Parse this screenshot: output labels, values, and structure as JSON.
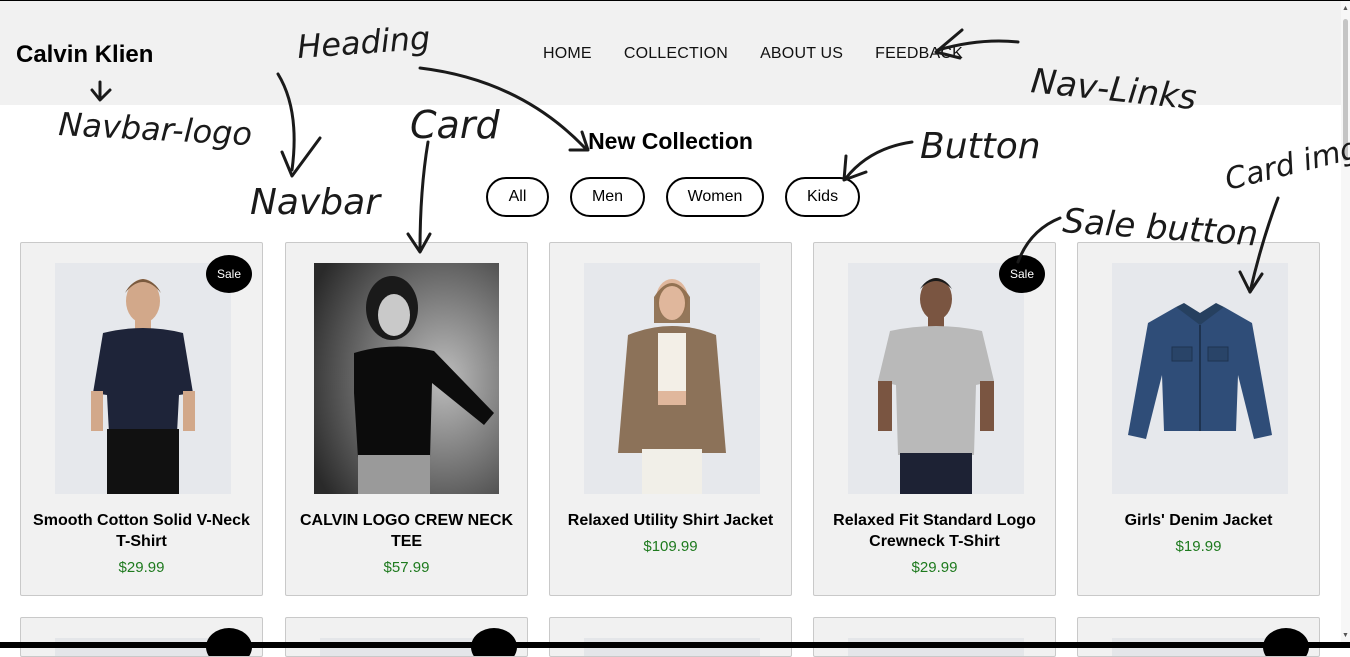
{
  "navbar": {
    "logo": "Calvin Klien",
    "links": [
      "HOME",
      "COLLECTION",
      "ABOUT US",
      "FEEDBACK"
    ]
  },
  "heading": "New Collection",
  "filters": [
    "All",
    "Men",
    "Women",
    "Kids"
  ],
  "products": [
    {
      "name": "Smooth Cotton Solid V-Neck T-Shirt",
      "price": "$29.99",
      "sale": "Sale"
    },
    {
      "name": "CALVIN LOGO CREW NECK TEE",
      "price": "$57.99",
      "sale": ""
    },
    {
      "name": "Relaxed Utility Shirt Jacket",
      "price": "$109.99",
      "sale": ""
    },
    {
      "name": "Relaxed Fit Standard Logo Crewneck T-Shirt",
      "price": "$29.99",
      "sale": "Sale"
    },
    {
      "name": "Girls' Denim Jacket",
      "price": "$19.99",
      "sale": ""
    }
  ],
  "annotations": {
    "heading": "Heading",
    "nav_links": "Nav-Links",
    "navbar_logo": "Navbar-logo",
    "card": "Card",
    "navbar": "Navbar",
    "button": "Button",
    "sale_button": "Sale button",
    "card_img": "Card img"
  },
  "colors": {
    "navbar_bg": "#f1f1f1",
    "card_bg": "#f1f1f1",
    "price": "#1e7a1e",
    "badge": "#000000"
  }
}
